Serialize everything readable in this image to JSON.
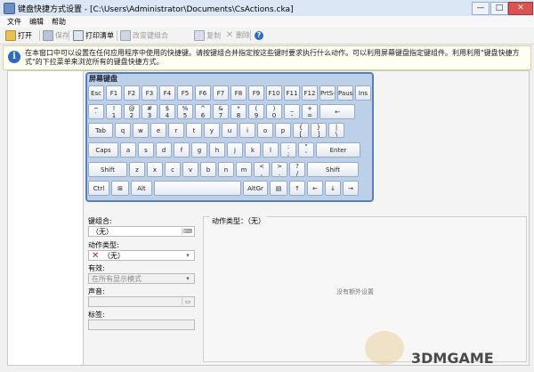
{
  "window": {
    "title": "键盘快捷方式设置 - [C:\\Users\\Administrator\\Documents\\CsActions.cka]",
    "controls": {
      "minimize": "—",
      "maximize": "□",
      "close": "✕"
    }
  },
  "menu": {
    "file": "文件",
    "edit": "编辑",
    "help": "帮助"
  },
  "toolbar": {
    "open": "打开",
    "save": "保存",
    "print_list": "打印清单",
    "change_combo": "改变键组合",
    "copy": "复制",
    "delete": "删除",
    "help_icon": "?"
  },
  "info": {
    "icon": "i",
    "message": "在本窗口中可以设置在任何应用程序中使用的快捷键。请按键组合并指定按这些键时要求执行什么动作。可以利用屏幕键盘指定键组件。利用利用\"键盘快捷方式\"的下拉菜单来浏览所有的键盘快捷方式。"
  },
  "keyboard": {
    "title": "屏幕键盘",
    "row1": [
      "Esc",
      "F1",
      "F2",
      "F3",
      "F4",
      "F5",
      "F6",
      "F7",
      "F8",
      "F9",
      "F10",
      "F11",
      "F12",
      "PrtS-",
      "Paus",
      "Ins"
    ],
    "row2": [
      [
        "~",
        "`"
      ],
      [
        "!",
        "1"
      ],
      [
        "@",
        "2"
      ],
      [
        "#",
        "3"
      ],
      [
        "$",
        "4"
      ],
      [
        "%",
        "5"
      ],
      [
        "^",
        "6"
      ],
      [
        "&",
        "7"
      ],
      [
        "*",
        "8"
      ],
      [
        "(",
        "9"
      ],
      [
        ")",
        "0"
      ],
      [
        "_",
        "-"
      ],
      [
        "+",
        "="
      ]
    ],
    "row2_back": "←",
    "row3_tab": "Tab",
    "row3": [
      "q",
      "w",
      "e",
      "r",
      "t",
      "y",
      "u",
      "i",
      "o",
      "p"
    ],
    "row3_br": [
      [
        "{",
        "["
      ],
      [
        "}",
        "]"
      ],
      [
        "|",
        "\\"
      ]
    ],
    "row4_caps": "Caps",
    "row4": [
      "a",
      "s",
      "d",
      "f",
      "g",
      "h",
      "j",
      "k",
      "l"
    ],
    "row4_p": [
      [
        ":",
        ";"
      ],
      [
        "\"",
        "'"
      ]
    ],
    "row4_enter": "Enter",
    "row5_shift_l": "Shift",
    "row5": [
      "z",
      "x",
      "c",
      "v",
      "b",
      "n",
      "m"
    ],
    "row5_p": [
      [
        "<",
        ","
      ],
      [
        ">",
        "."
      ],
      [
        "?",
        "/"
      ]
    ],
    "row5_shift_r": "Shift",
    "row6": {
      "ctrl": "Ctrl",
      "win": "⊞",
      "alt": "Alt",
      "altgr": "AltGr",
      "menu": "▤",
      "up": "↑",
      "left": "←",
      "down": "↓",
      "right": "→"
    }
  },
  "form": {
    "key_combo_label": "键组合:",
    "key_combo_value": "（无）",
    "action_type_label": "动作类型:",
    "action_type_value": "（无）",
    "valid_label": "有效:",
    "valid_value": "在所有显示模式",
    "sound_label": "声音:",
    "sound_value": "",
    "tag_label": "标签:",
    "tag_value": ""
  },
  "action_panel": {
    "title": "动作类型：（无）",
    "no_extra": "没有额外设置"
  },
  "watermark": {
    "brand": "3DMGAME"
  }
}
